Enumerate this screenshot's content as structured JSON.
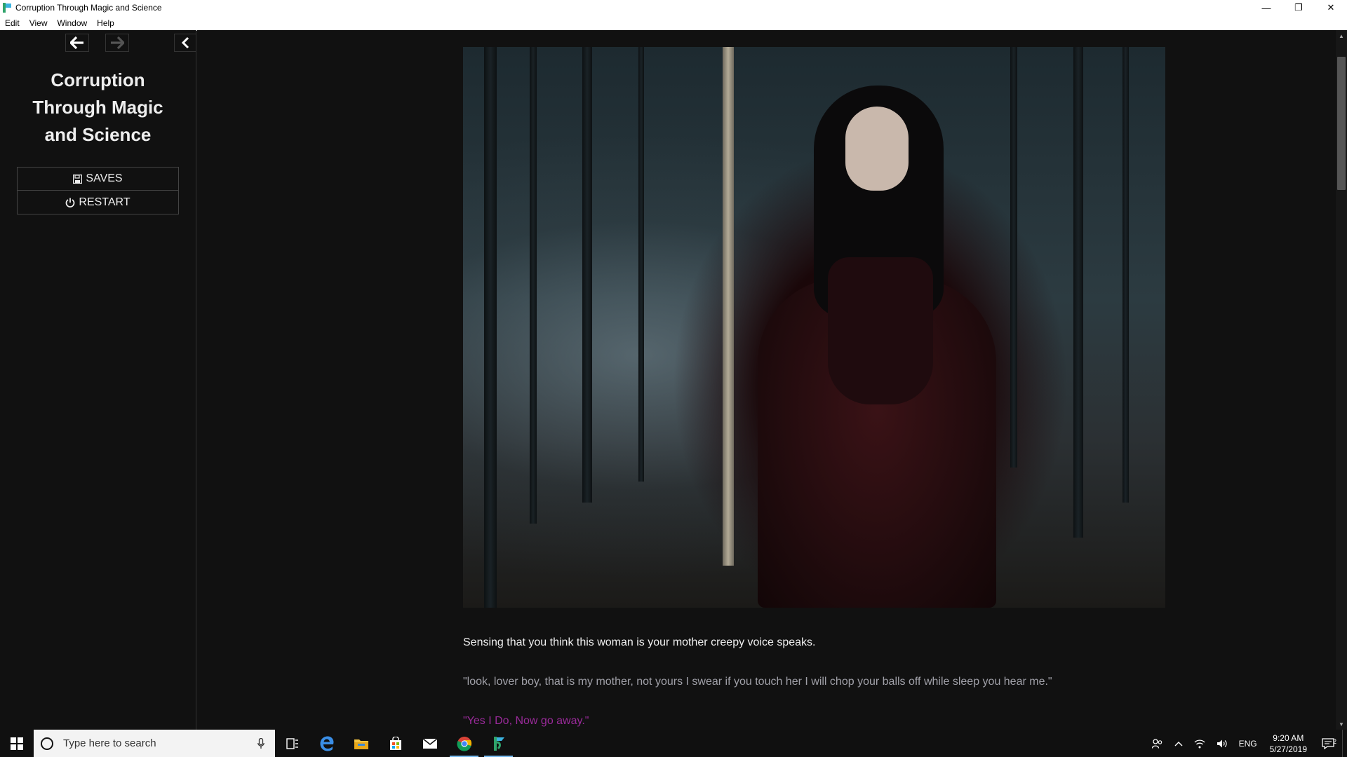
{
  "window": {
    "title": "Corruption Through Magic and Science",
    "minimize_glyph": "—",
    "restore_glyph": "❐",
    "close_glyph": "✕"
  },
  "menu": {
    "items": [
      "Edit",
      "View",
      "Window",
      "Help"
    ]
  },
  "sidebar": {
    "story_title": "Corruption Through Magic and Science",
    "saves_label": "SAVES",
    "restart_label": "RESTART"
  },
  "passage": {
    "narration": "Sensing that you think this woman is your mother creepy voice speaks.",
    "voice_line": "\"look, lover boy, that is my mother, not yours I swear if you touch her I will chop your balls off while sleep you hear me.\"",
    "player_line": "\"Yes I Do, Now go away.\""
  },
  "taskbar": {
    "search_placeholder": "Type here to search",
    "language": "ENG",
    "time": "9:20 AM",
    "date": "5/27/2019",
    "notification_count": "2"
  },
  "colors": {
    "background": "#111111",
    "text": "#f0f0f0",
    "voice_text": "#a0a0a8",
    "player_text": "#9a2a9a",
    "taskbar": "#101010",
    "accent": "#76b9ed"
  },
  "icons": {
    "back": "arrow-left-icon",
    "forward": "arrow-right-icon",
    "collapse": "chevron-left-icon",
    "saves": "floppy-disk-icon",
    "restart": "power-icon",
    "debug": "bug-icon",
    "next": "arrow-right-icon"
  }
}
